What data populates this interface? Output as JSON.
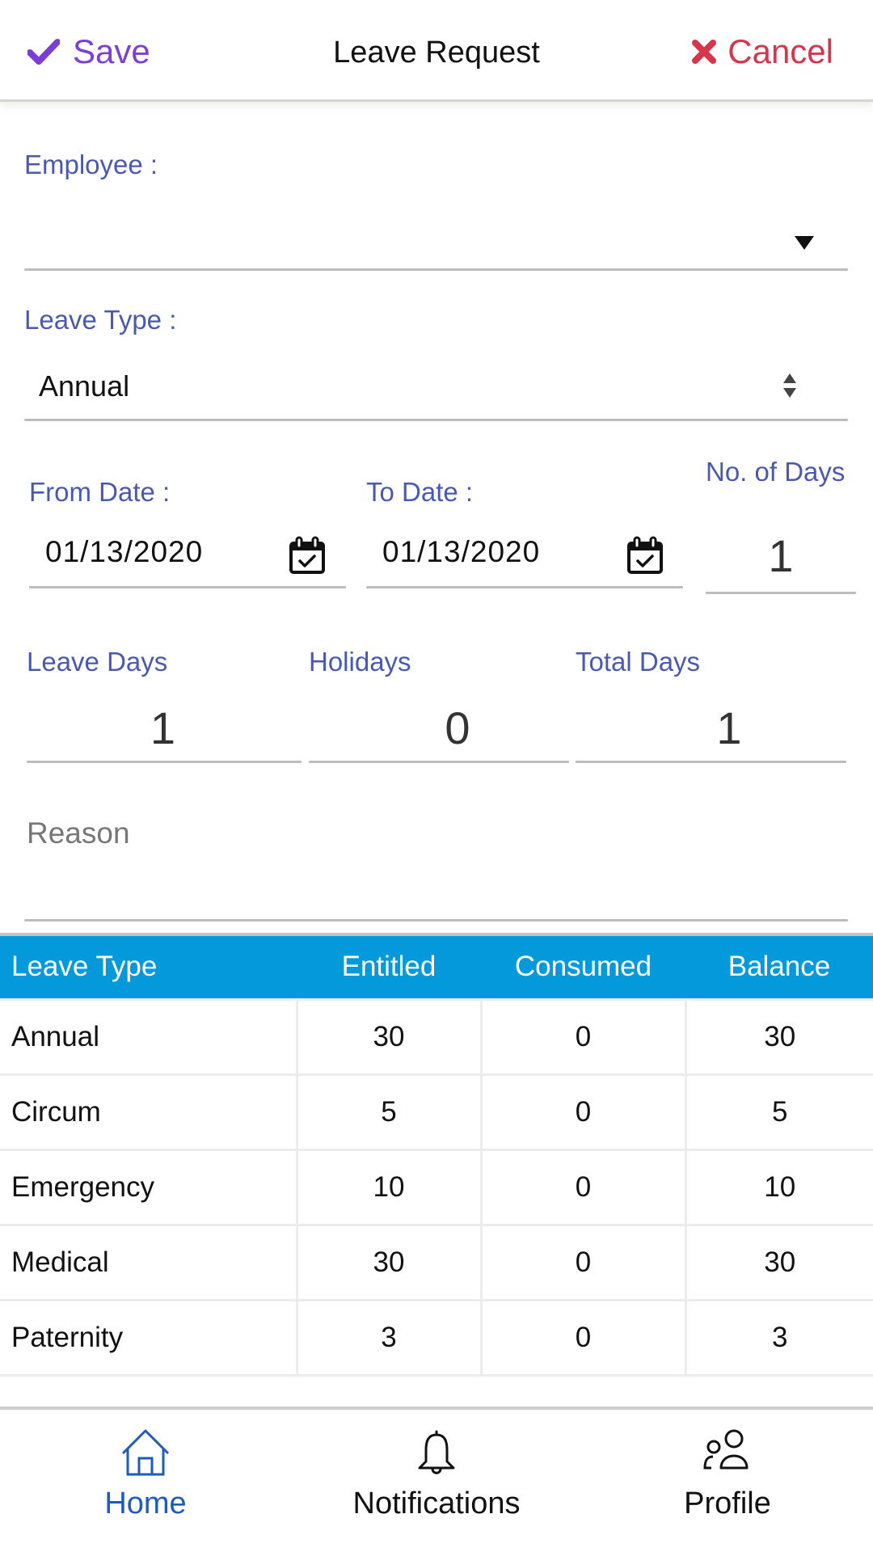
{
  "header": {
    "save_label": "Save",
    "title": "Leave Request",
    "cancel_label": "Cancel",
    "save_color": "#7b3fd6",
    "cancel_color": "#d5364b"
  },
  "form": {
    "employee": {
      "label": "Employee :",
      "value": ""
    },
    "leave_type": {
      "label": "Leave Type :",
      "value": "Annual"
    },
    "from_date": {
      "label": "From Date :",
      "value": "01/13/2020"
    },
    "to_date": {
      "label": "To Date :",
      "value": "01/13/2020"
    },
    "no_of_days": {
      "label": "No. of Days",
      "value": "1"
    },
    "leave_days": {
      "label": "Leave Days",
      "value": "1"
    },
    "holidays": {
      "label": "Holidays",
      "value": "0"
    },
    "total_days": {
      "label": "Total Days",
      "value": "1"
    },
    "reason": {
      "placeholder": "Reason",
      "value": ""
    }
  },
  "balance_table": {
    "header_color": "#0499db",
    "columns": [
      "Leave Type",
      "Entitled",
      "Consumed",
      "Balance"
    ],
    "rows": [
      [
        "Annual",
        "30",
        "0",
        "30"
      ],
      [
        "Circum",
        "5",
        "0",
        "5"
      ],
      [
        "Emergency",
        "10",
        "0",
        "10"
      ],
      [
        "Medical",
        "30",
        "0",
        "30"
      ],
      [
        "Paternity",
        "3",
        "0",
        "3"
      ]
    ]
  },
  "bottom_nav": {
    "items": [
      {
        "label": "Home",
        "icon": "home-icon",
        "active": true
      },
      {
        "label": "Notifications",
        "icon": "bell-icon",
        "active": false
      },
      {
        "label": "Profile",
        "icon": "users-icon",
        "active": false
      }
    ],
    "active_color": "#1f5bb8"
  }
}
